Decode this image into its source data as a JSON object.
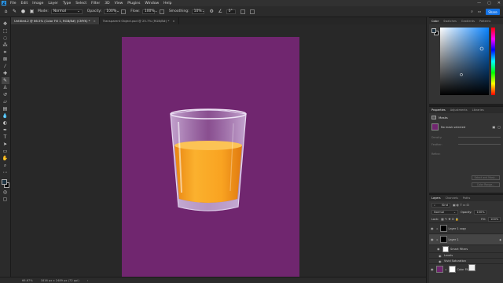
{
  "app": {
    "logo": "Ps"
  },
  "menu": [
    "File",
    "Edit",
    "Image",
    "Layer",
    "Type",
    "Select",
    "Filter",
    "3D",
    "View",
    "Plugins",
    "Window",
    "Help"
  ],
  "window_controls": [
    "—",
    "▢",
    "✕"
  ],
  "options": {
    "mode_label": "Mode:",
    "mode_value": "Normal",
    "opacity_label": "Opacity:",
    "opacity_value": "100%",
    "flow_label": "Flow:",
    "flow_value": "100%",
    "smoothing_label": "Smoothing:",
    "smoothing_value": "10%",
    "angle_value": "0°",
    "share_label": "Share"
  },
  "tabs": [
    {
      "label": "Untitled-2 @ 66.5% (Color Fill 1, RGB/8#) (CMYK) *",
      "active": true
    },
    {
      "label": "Transparent Object.psd @ 25.7% (RGB/8#) *",
      "active": false
    }
  ],
  "status": {
    "zoom": "66.67%",
    "doc_size": "1816 px x 2489 px (72 ppi)"
  },
  "color_panel": {
    "tabs": [
      "Color",
      "Swatches",
      "Gradients",
      "Patterns"
    ],
    "active": 0
  },
  "properties_panel": {
    "tabs": [
      "Properties",
      "Adjustments",
      "Libraries"
    ],
    "active": 0,
    "title": "Masks",
    "mask_label": "No mask selected",
    "density_label": "Density:",
    "feather_label": "Feather:",
    "refine_label": "Refine:",
    "select_btn": "Select and Mask...",
    "color_range_btn": "Color Range..."
  },
  "layers_panel": {
    "tabs": [
      "Layers",
      "Channels",
      "Paths"
    ],
    "active": 0,
    "kind_label": "Kind",
    "blend_mode": "Normal",
    "opacity_label": "Opacity:",
    "opacity_value": "100%",
    "lock_label": "Lock:",
    "fill_label": "Fill:",
    "fill_value": "100%",
    "layers": [
      {
        "name": "Layer 1 copy",
        "thumb": "glass",
        "thumb2": "black",
        "kind": "layer"
      },
      {
        "name": "Layer 1",
        "thumb": "glass",
        "thumb2": "black",
        "kind": "layer",
        "selected": true
      },
      {
        "name": "Smart Filters",
        "thumb": "white",
        "kind": "sub"
      },
      {
        "name": "Levels",
        "thumb": "",
        "kind": "sub"
      },
      {
        "name": "Vivid Saturation",
        "thumb": "",
        "kind": "sub"
      },
      {
        "name": "Color Fill 1",
        "thumb": "purple",
        "thumb2": "white",
        "kind": "layer"
      }
    ]
  },
  "colors": {
    "artboard": "#70266f",
    "juice": "#f7a21e",
    "accent": "#1473e6"
  }
}
